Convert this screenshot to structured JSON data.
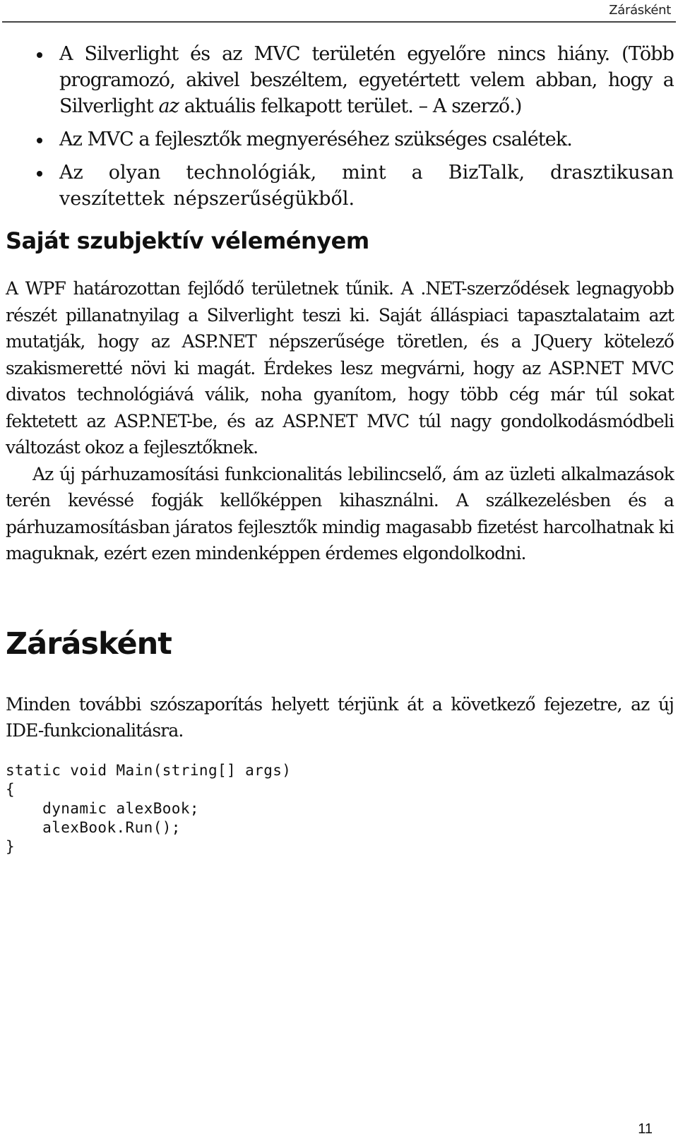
{
  "header": {
    "running_title": "Zárásként"
  },
  "bullets": [
    {
      "before": "A Silverlight és az MVC területén egyelőre nincs hiány. (Több programozó, akivel beszéltem, egyetértett velem abban, hogy a Silverlight ",
      "emphasis": "az",
      "after": " aktuális felkapott terület. – A szerző.)"
    },
    {
      "before": "Az MVC a fejlesztők megnyeréséhez szükséges csalétek.",
      "emphasis": "",
      "after": ""
    },
    {
      "before": "Az olyan technológiák, mint a BizTalk, drasztikusan veszítettek népszerűségükből.",
      "emphasis": "",
      "after": ""
    }
  ],
  "section": {
    "heading": "Saját szubjektív véleményem",
    "paragraphs": [
      "A WPF határozottan fejlődő területnek tűnik. A .NET-szerződések legnagyobb részét pillanatnyilag a Silverlight teszi ki. Saját álláspiaci tapasztalataim azt mutatják, hogy az ASP.NET népszerűsége töretlen, és a JQuery kötelező szakismeretté növi ki magát. Érdekes lesz megvárni, hogy az ASP.NET MVC divatos technológiává válik, noha gyanítom, hogy több cég már túl sokat fektetett az ASP.NET-be, és az ASP.NET MVC túl nagy gondolkodásmódbeli változást okoz a fejlesztőknek.",
      "Az új párhuzamosítási funkcionalitás lebilincselő, ám az üzleti alkalmazások terén kevéssé fogják kellőképpen kihasználni. A szálkezelésben és a párhuzamosításban járatos fejlesztők mindig magasabb fizetést harcolhatnak ki maguknak, ezért ezen mindenképpen érdemes elgondolkodni."
    ]
  },
  "chapter": {
    "heading": "Zárásként",
    "paragraph": "Minden további szószaporítás helyett térjünk át a következő fejezetre, az új IDE-funkcionalitásra.",
    "code_lines": [
      "static void Main(string[] args)",
      "{",
      "    dynamic alexBook;",
      "    alexBook.Run();",
      "}"
    ]
  },
  "footer": {
    "page_number": "11"
  }
}
